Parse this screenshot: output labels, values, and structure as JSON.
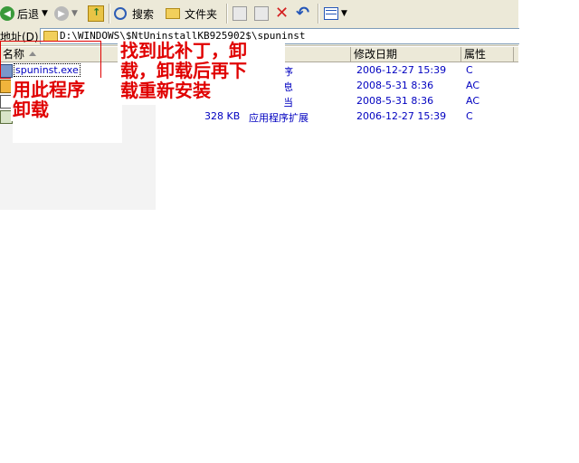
{
  "toolbar": {
    "back_label": "后退",
    "search_label": "搜索",
    "folders_label": "文件夹"
  },
  "address": {
    "label": "地址(D)",
    "value": "D:\\WINDOWS\\$NtUninstallKB925902$\\spuninst"
  },
  "columns": {
    "name": "名称",
    "modified": "修改日期",
    "attributes": "属性"
  },
  "files": [
    {
      "name": "spuninst.exe",
      "size": "",
      "type": "序",
      "modified": "2006-12-27 15:39",
      "attr": "C"
    },
    {
      "name": "",
      "size": "",
      "type": "息",
      "modified": "2008-5-31 8:36",
      "attr": "AC"
    },
    {
      "name": "",
      "size": "",
      "type": "当",
      "modified": "2008-5-31 8:36",
      "attr": "AC"
    },
    {
      "name": "",
      "size": "328 KB",
      "type": "应用程序扩展",
      "modified": "2006-12-27 15:39",
      "attr": "C"
    }
  ],
  "annotations": {
    "uninstall_with": "用此程序\n卸载",
    "find_patch": "找到此补丁，卸\n载，卸载后再下\n载重新安装"
  },
  "colors": {
    "annotation": "#e00000",
    "file_text": "#0000c0",
    "toolbar_bg": "#ece9d8"
  }
}
